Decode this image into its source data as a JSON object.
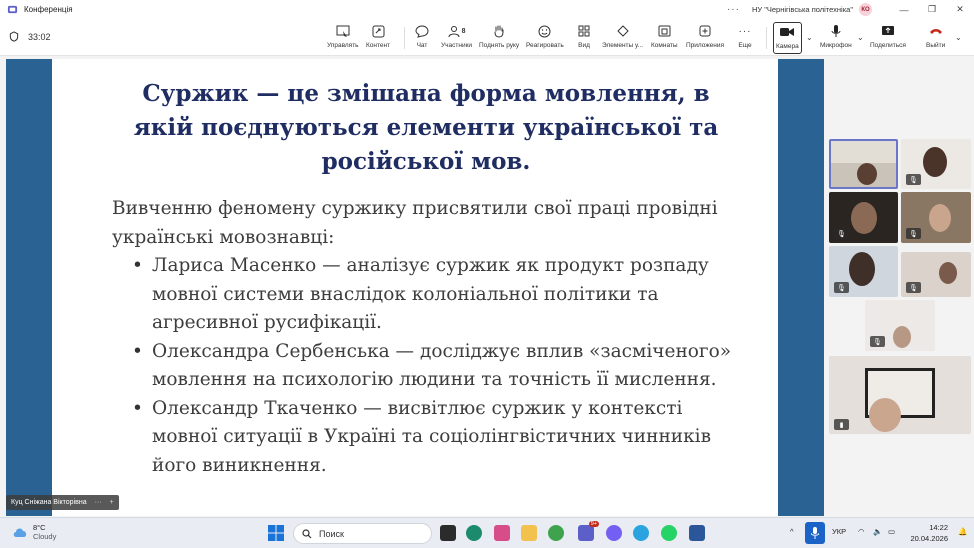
{
  "window": {
    "title": "Конференція",
    "organization": "НУ \"Чернігівська політехніка\"",
    "avatar_initials": "КО",
    "more_icon": "ellipsis-icon"
  },
  "toolbar": {
    "timer": "33:02",
    "buttons": {
      "control": "Управлять",
      "content": "Контент",
      "chat": "Чат",
      "participants": "Участники",
      "participants_count": "8",
      "raise_hand": "Поднять руку",
      "react": "Реагировать",
      "view": "Вид",
      "elements": "Элементы у...",
      "rooms": "Комнаты",
      "apps": "Приложения",
      "more": "Еще",
      "camera": "Камера",
      "mic": "Микрофон",
      "share": "Поделиться",
      "leave": "Выйти"
    }
  },
  "slide": {
    "title": "Суржик — це змішана форма мовлення, в якій поєднуються елементи української та російської мов.",
    "intro": "Вивченню феномену суржику присвятили свої праці провідні українські мовознавці:",
    "bullets": [
      "Лариса Масенко — аналізує суржик як продукт розпаду мовної системи внаслідок колоніальної політики та агресивної русифікації.",
      "Олександра Сербенська — досліджує вплив «засміченого» мовлення на психологію людини та точність її мислення.",
      "Олександр Ткаченко — висвітлює суржик у контексті мовної ситуації в Україні та соціолінгвістичних чинників його виникнення."
    ],
    "presenter_name": "Куц Сніжана Вікторівна",
    "presenter_more": "···",
    "presenter_add": "+"
  },
  "colors": {
    "slide_bar": "#2a6294",
    "slide_title": "#1f2d62",
    "leave": "#c42b1c",
    "accent": "#1b63c6"
  },
  "taskbar": {
    "temperature": "8°C",
    "weather": "Cloudy",
    "search_placeholder": "Поиск",
    "teams_badge": "9+",
    "language": "УКР",
    "time": "14:22",
    "date": "20.04.2026",
    "tray_chevron": "^"
  }
}
